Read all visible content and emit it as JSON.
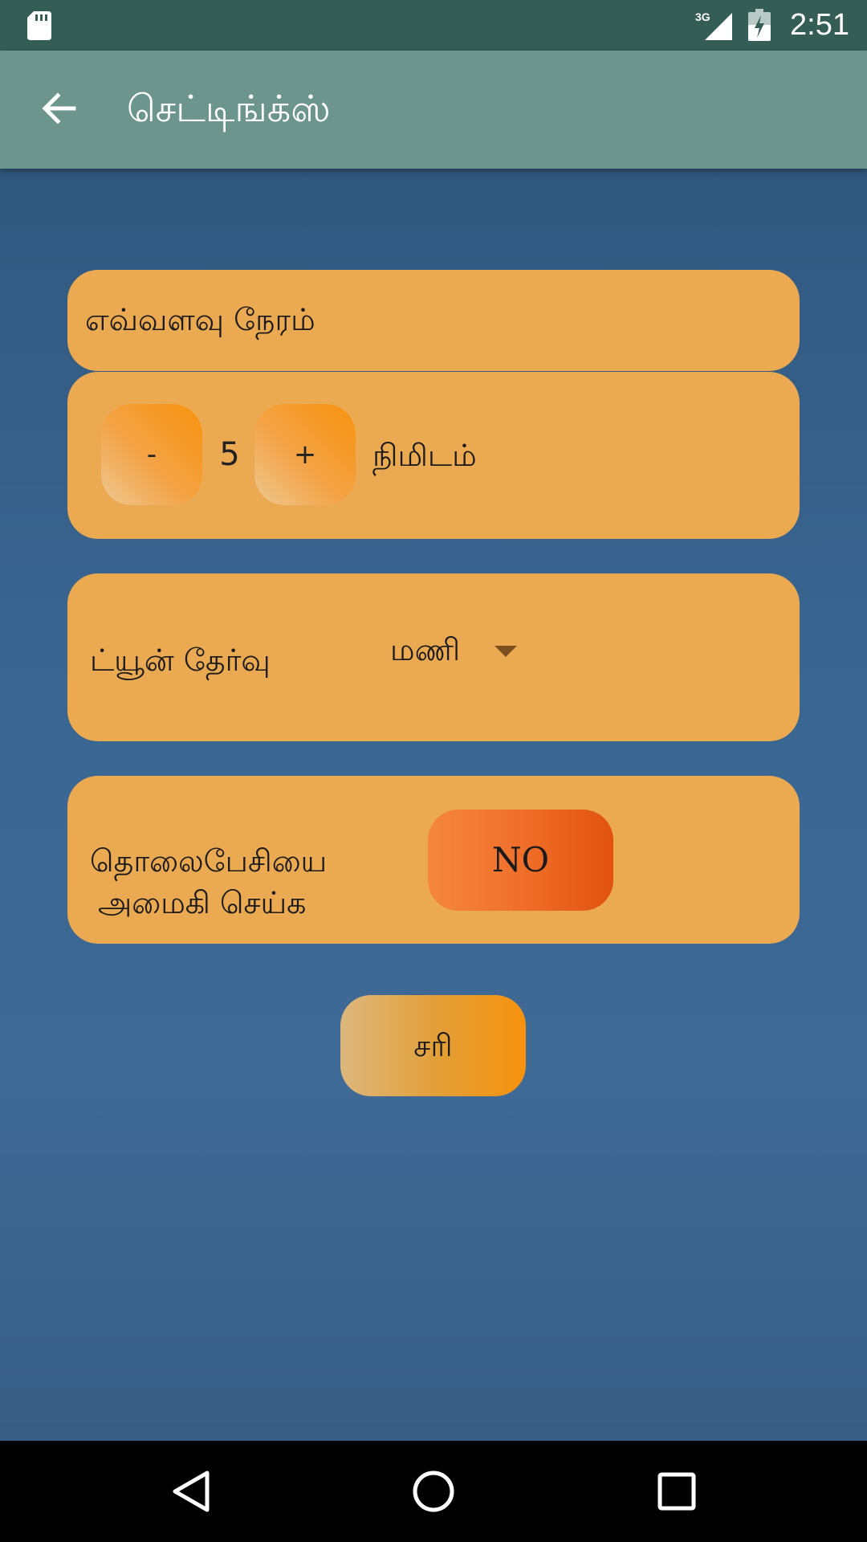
{
  "status_bar": {
    "network": "3G",
    "time": "2:51",
    "icons": [
      "sd-card-icon",
      "signal-icon",
      "battery-icon"
    ]
  },
  "app_bar": {
    "title": "செட்டிங்க்ஸ்",
    "back_icon": "arrow-left-icon"
  },
  "duration": {
    "label": "எவ்வளவு நேரம்",
    "minus_label": "-",
    "value": "5",
    "plus_label": "+",
    "unit": "நிமிடம்"
  },
  "tune": {
    "label": "ட்யூன் தேர்வு",
    "selected": "மணி",
    "arrow_icon": "dropdown-arrow-icon"
  },
  "silent": {
    "label_line1": "தொலைபேசியை",
    "label_line2": "அமைகி செய்க",
    "toggle_label": "NO"
  },
  "ok_button_label": "சரி",
  "nav_bar": {
    "icons": [
      "back-triangle-icon",
      "home-circle-icon",
      "recents-square-icon"
    ]
  },
  "colors": {
    "status_bar": "#345d55",
    "app_bar": "#6b958d",
    "card": "#eba951",
    "accent_orange": "#f6920e",
    "toggle_orange": "#e1520f",
    "background": "#3a6692"
  }
}
